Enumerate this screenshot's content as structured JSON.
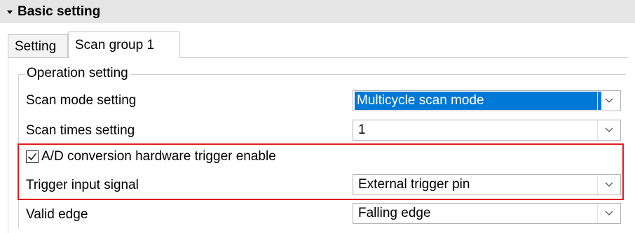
{
  "section": {
    "title": "Basic setting",
    "caret_icon": "caret-down-icon"
  },
  "tabs": [
    {
      "label": "Setting",
      "active": false
    },
    {
      "label": "Scan group 1",
      "active": true
    }
  ],
  "group": {
    "label": "Operation setting"
  },
  "fields": {
    "scan_mode": {
      "label": "Scan mode setting",
      "value": "Multicycle scan mode"
    },
    "scan_times": {
      "label": "Scan times setting",
      "value": "1"
    },
    "hw_trigger": {
      "label": "A/D conversion hardware trigger enable",
      "checked": true
    },
    "trigger_input": {
      "label": "Trigger input signal",
      "value": "External trigger pin"
    },
    "valid_edge": {
      "label": "Valid edge",
      "value": "Falling edge"
    }
  },
  "colors": {
    "highlight": "#e21b1b",
    "selection": "#0078d7",
    "header_bg": "#e6e6e6"
  }
}
